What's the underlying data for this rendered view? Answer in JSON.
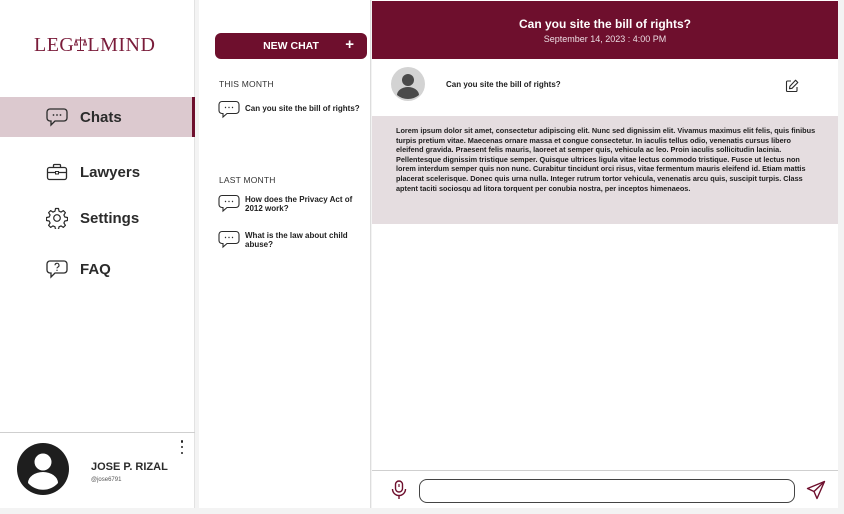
{
  "brand": {
    "logo_text": "LEGALMIND",
    "logo_parts": [
      "LEG",
      "L",
      "MIND"
    ],
    "primary_color": "#6e0f2d",
    "highlight_color": "#dcc9cf"
  },
  "nav": {
    "items": [
      {
        "label": "Chats",
        "icon": "chat-bubble-icon",
        "active": true
      },
      {
        "label": "Lawyers",
        "icon": "briefcase-icon",
        "active": false
      },
      {
        "label": "Settings",
        "icon": "gear-icon",
        "active": false
      },
      {
        "label": "FAQ",
        "icon": "question-bubble-icon",
        "active": false
      }
    ]
  },
  "user": {
    "name": "JOSE P. RIZAL",
    "handle": "@jose6791",
    "avatar_icon": "user-avatar-icon",
    "menu_icon": "kebab-menu-icon"
  },
  "history": {
    "new_chat_label": "NEW CHAT",
    "new_chat_icon_glyph": "+",
    "sections": [
      {
        "label": "THIS MONTH",
        "items": [
          "Can you site the bill of rights?"
        ]
      },
      {
        "label": "LAST MONTH",
        "items": [
          "How does the Privacy Act of 2012 work?",
          "What is the law about child abuse?"
        ]
      }
    ]
  },
  "chat": {
    "title": "Can you site the bill of rights?",
    "date": "September 14, 2023 : 4:00 PM",
    "question": "Can you site the bill of rights?",
    "answer": "Lorem ipsum dolor sit amet, consectetur adipiscing elit. Nunc sed dignissim elit. Vivamus maximus elit felis, quis finibus turpis pretium vitae. Maecenas ornare massa et congue consectetur. In iaculis tellus odio, venenatis cursus libero eleifend gravida. Praesent felis mauris, laoreet at semper quis, vehicula ac leo. Proin iaculis sollicitudin lacinia. Pellentesque dignissim tristique semper. Quisque ultrices ligula vitae lectus commodo tristique. Fusce ut lectus non lorem interdum semper quis non nunc. Curabitur tincidunt orci risus, vitae fermentum mauris eleifend id. Etiam mattis placerat scelerisque. Donec quis urna nulla. Integer rutrum tortor vehicula, venenatis arcu quis, suscipit turpis. Class aptent taciti sociosqu ad litora torquent per conubia nostra, per inceptos himenaeos.",
    "input_value": "",
    "input_placeholder": "",
    "icons": {
      "edit": "edit-icon",
      "mic": "microphone-icon",
      "send": "send-icon"
    }
  }
}
